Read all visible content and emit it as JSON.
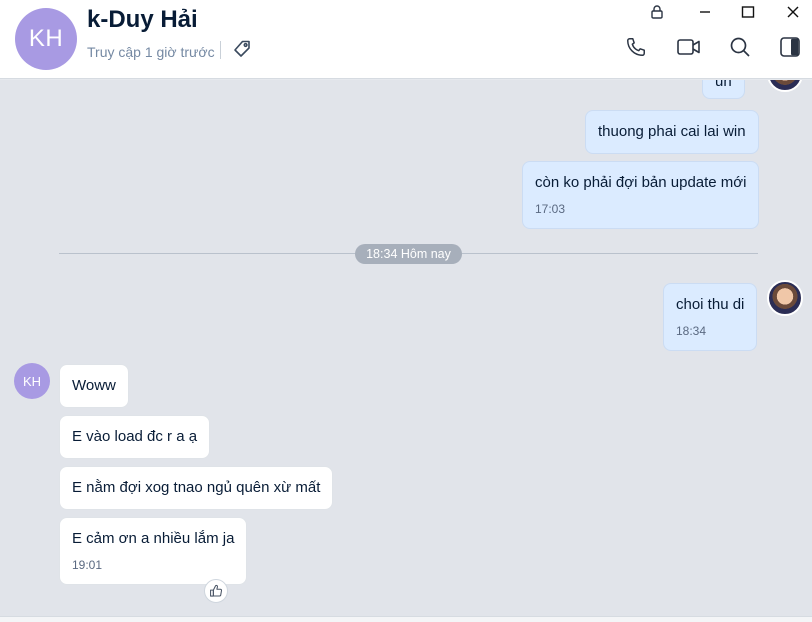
{
  "header": {
    "avatar_initials": "KH",
    "avatar_color": "#a89ae3",
    "contact_name": "k-Duy Hải",
    "last_seen": "Truy cập 1 giờ trước",
    "icons": [
      "tag-icon",
      "phone-icon",
      "video-call-icon",
      "search-icon",
      "sidebar-toggle-icon"
    ]
  },
  "window_controls": [
    "lock-icon",
    "minimize-icon",
    "maximize-icon",
    "close-icon"
  ],
  "conversation": {
    "date_divider": "18:34 Hôm nay",
    "messages": [
      {
        "sender": "me",
        "text": "un",
        "time": ""
      },
      {
        "sender": "me",
        "text": "thuong phai cai lai win",
        "time": ""
      },
      {
        "sender": "me",
        "text": "còn ko phải đợi bản update mới",
        "time": "17:03"
      },
      {
        "sender": "me",
        "text": "choi thu di",
        "time": "18:34"
      },
      {
        "sender": "them",
        "text": "Woww",
        "time": ""
      },
      {
        "sender": "them",
        "text": "E vào load đc r a ạ",
        "time": ""
      },
      {
        "sender": "them",
        "text": "E nằm đợi xog tnao ngủ quên xừ mất",
        "time": ""
      },
      {
        "sender": "them",
        "text": "E cảm ơn a nhiều lắm ja",
        "time": "19:01"
      }
    ],
    "sender_avatar_initials": "KH",
    "reaction_icon": "thumbs-up-icon"
  },
  "colors": {
    "my_bubble": "#dbebff",
    "their_bubble": "#ffffff",
    "chat_background": "#e1e4ea"
  }
}
